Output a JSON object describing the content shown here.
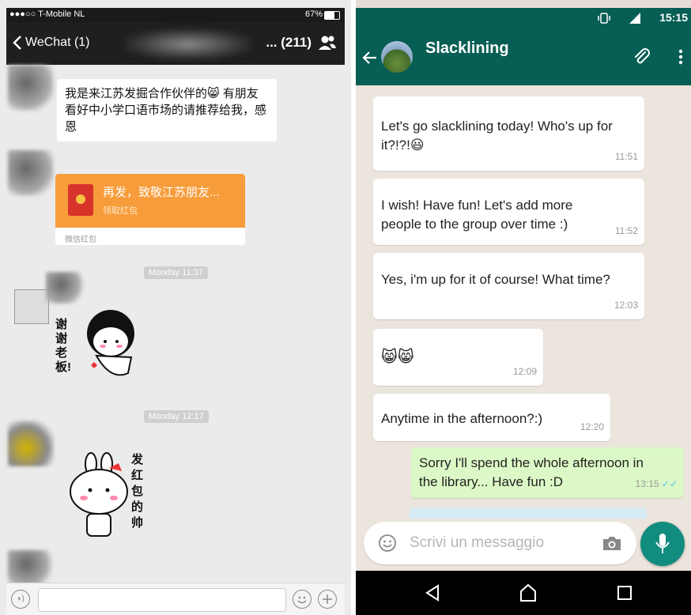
{
  "wechat": {
    "status": {
      "carrier": "●●●○○ T-Mobile NL",
      "battery": "67%"
    },
    "nav": {
      "back_label": "WeChat (1)",
      "member_count": "... (211)"
    },
    "messages": {
      "text1": "我是来江苏发掘合作伙伴的😸 有朋友看好中小学口语市场的请推荐给我，感恩",
      "red_packet_title": "再发，致敬江苏朋友...",
      "red_packet_sub": "领取红包",
      "red_packet_footer": "微信红包",
      "time1": "Monday 11:37",
      "sticker1_text": "谢谢老板!",
      "time2": "Monday 12:17",
      "sticker2_text": "发红包的帅"
    }
  },
  "whatsapp": {
    "status": {
      "time": "15:15"
    },
    "header": {
      "title": "Slacklining"
    },
    "messages": [
      {
        "text": "Let's go slacklining today! Who's up for it?!?!😃",
        "time": "11:51"
      },
      {
        "text": "I wish!  Have fun! Let's add more people to the group over time :)",
        "time": "11:52"
      },
      {
        "text": "Yes, i'm up for it of course! What time?",
        "time": "12:03"
      },
      {
        "text": "😸😸",
        "time": "12:09"
      },
      {
        "text": "Anytime in the afternoon?:)",
        "time": "12:20"
      },
      {
        "text": "Sorry I'll spend the whole afternoon in the library... Have fun :D",
        "time": "13:15"
      }
    ],
    "input": {
      "placeholder": "Scrivi un messaggio"
    },
    "colors": {
      "header": "#075e54",
      "accent": "#128c7e",
      "out_bubble": "#dcf8c6"
    }
  }
}
